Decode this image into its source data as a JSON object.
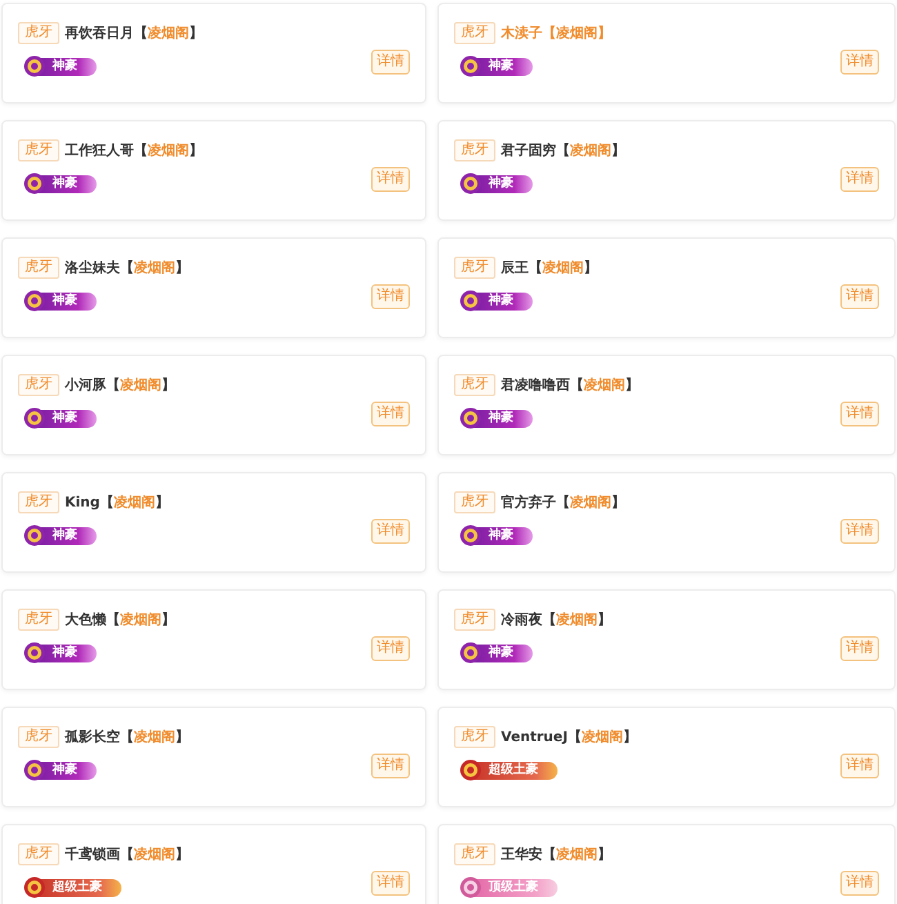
{
  "cards": [
    {
      "platform": "虎牙",
      "name": "再饮吞日月",
      "name_highlighted": false,
      "guild": "【凌烟阁】",
      "badge": {
        "kind": "shenhao",
        "label": "神豪"
      },
      "button": "详情"
    },
    {
      "platform": "虎牙",
      "name": "木渎子",
      "name_highlighted": true,
      "guild": "【凌烟阁】",
      "badge": {
        "kind": "shenhao",
        "label": "神豪"
      },
      "button": "详情"
    },
    {
      "platform": "虎牙",
      "name": "工作狂人哥",
      "name_highlighted": false,
      "guild": "【凌烟阁】",
      "badge": {
        "kind": "shenhao",
        "label": "神豪"
      },
      "button": "详情"
    },
    {
      "platform": "虎牙",
      "name": "君子固穷",
      "name_highlighted": false,
      "guild": "【凌烟阁】",
      "badge": {
        "kind": "shenhao",
        "label": "神豪"
      },
      "button": "详情"
    },
    {
      "platform": "虎牙",
      "name": "洛尘妹夫",
      "name_highlighted": false,
      "guild": "【凌烟阁】",
      "badge": {
        "kind": "shenhao",
        "label": "神豪"
      },
      "button": "详情"
    },
    {
      "platform": "虎牙",
      "name": "辰王",
      "name_highlighted": false,
      "guild": "【凌烟阁】",
      "badge": {
        "kind": "shenhao",
        "label": "神豪"
      },
      "button": "详情"
    },
    {
      "platform": "虎牙",
      "name": "小河豚",
      "name_highlighted": false,
      "guild": "【凌烟阁】",
      "badge": {
        "kind": "shenhao",
        "label": "神豪"
      },
      "button": "详情"
    },
    {
      "platform": "虎牙",
      "name": "君凌噜噜西",
      "name_highlighted": false,
      "guild": "【凌烟阁】",
      "badge": {
        "kind": "shenhao",
        "label": "神豪"
      },
      "button": "详情"
    },
    {
      "platform": "虎牙",
      "name": "King",
      "name_highlighted": false,
      "guild": "【凌烟阁】",
      "badge": {
        "kind": "shenhao",
        "label": "神豪"
      },
      "button": "详情"
    },
    {
      "platform": "虎牙",
      "name": "官方弃子",
      "name_highlighted": false,
      "guild": "【凌烟阁】",
      "badge": {
        "kind": "shenhao",
        "label": "神豪"
      },
      "button": "详情"
    },
    {
      "platform": "虎牙",
      "name": "大色懒",
      "name_highlighted": false,
      "guild": "【凌烟阁】",
      "badge": {
        "kind": "shenhao",
        "label": "神豪"
      },
      "button": "详情"
    },
    {
      "platform": "虎牙",
      "name": "冷雨夜",
      "name_highlighted": false,
      "guild": "【凌烟阁】",
      "badge": {
        "kind": "shenhao",
        "label": "神豪"
      },
      "button": "详情"
    },
    {
      "platform": "虎牙",
      "name": "孤影长空",
      "name_highlighted": false,
      "guild": "【凌烟阁】",
      "badge": {
        "kind": "shenhao",
        "label": "神豪"
      },
      "button": "详情"
    },
    {
      "platform": "虎牙",
      "name": "VentrueJ",
      "name_highlighted": false,
      "guild": "【凌烟阁】",
      "badge": {
        "kind": "chaoji",
        "label": "超级土豪"
      },
      "button": "详情"
    },
    {
      "platform": "虎牙",
      "name": "千鸢锁画",
      "name_highlighted": false,
      "guild": "【凌烟阁】",
      "badge": {
        "kind": "chaoji",
        "label": "超级土豪"
      },
      "button": "详情"
    },
    {
      "platform": "虎牙",
      "name": "王华安",
      "name_highlighted": false,
      "guild": "【凌烟阁】",
      "badge": {
        "kind": "dingji",
        "label": "顶级土豪"
      },
      "button": "详情"
    }
  ]
}
